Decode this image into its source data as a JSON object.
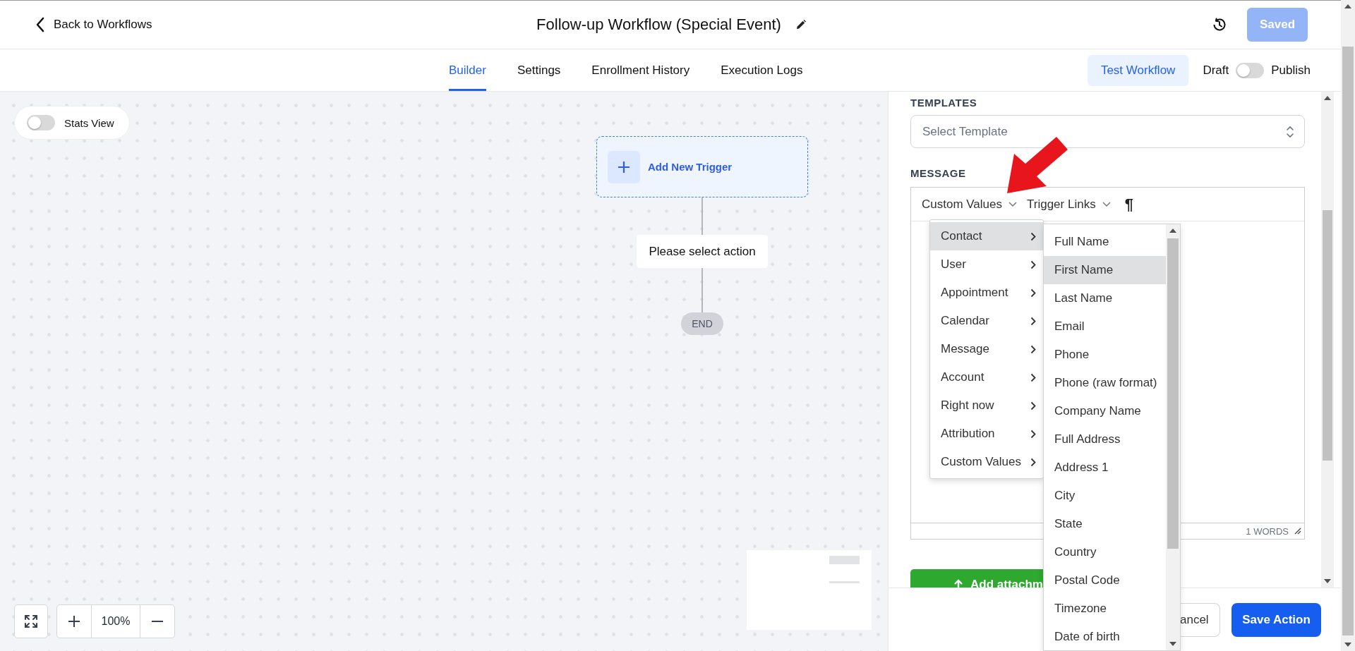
{
  "header": {
    "back_link": "Back to Workflows",
    "title": "Follow-up Workflow (Special Event)",
    "save_status": "Saved"
  },
  "tabs": [
    {
      "label": "Builder",
      "selected": true
    },
    {
      "label": "Settings",
      "selected": false
    },
    {
      "label": "Enrollment History",
      "selected": false
    },
    {
      "label": "Execution Logs",
      "selected": false
    }
  ],
  "test_button": "Test Workflow",
  "publish_toggle": {
    "off_label": "Draft",
    "on_label": "Publish",
    "on": false
  },
  "canvas": {
    "stats_view": {
      "label": "Stats View",
      "on": false
    },
    "nodes": [
      {
        "kind": "trigger",
        "label": "Add New Trigger"
      },
      {
        "kind": "action",
        "label": "Please select action"
      },
      {
        "kind": "end",
        "label": "END"
      }
    ],
    "zoom": "100%"
  },
  "panel": {
    "templates": {
      "label": "TEMPLATES",
      "placeholder": "Select Template"
    },
    "message": {
      "label": "MESSAGE",
      "toolbar": [
        {
          "kind": "dropdown",
          "label": "Custom Values"
        },
        {
          "kind": "dropdown",
          "label": "Trigger Links"
        },
        {
          "kind": "glyph",
          "label": "¶"
        }
      ],
      "word_count": "1 WORDS"
    },
    "attachment_button": "Add attachm",
    "cancel_button": "ancel",
    "save_button": "Save Action"
  },
  "menu": {
    "items": [
      {
        "label": "Contact",
        "selected": true
      },
      {
        "label": "User",
        "selected": false
      },
      {
        "label": "Appointment",
        "selected": false
      },
      {
        "label": "Calendar",
        "selected": false
      },
      {
        "label": "Message",
        "selected": false
      },
      {
        "label": "Account",
        "selected": false
      },
      {
        "label": "Right now",
        "selected": false
      },
      {
        "label": "Attribution",
        "selected": false
      },
      {
        "label": "Custom Values",
        "selected": false
      }
    ]
  },
  "submenu": {
    "items": [
      {
        "label": "Full Name",
        "selected": false
      },
      {
        "label": "First Name",
        "selected": true
      },
      {
        "label": "Last Name",
        "selected": false
      },
      {
        "label": "Email",
        "selected": false
      },
      {
        "label": "Phone",
        "selected": false
      },
      {
        "label": "Phone (raw format)",
        "selected": false
      },
      {
        "label": "Company Name",
        "selected": false
      },
      {
        "label": "Full Address",
        "selected": false
      },
      {
        "label": "Address 1",
        "selected": false
      },
      {
        "label": "City",
        "selected": false
      },
      {
        "label": "State",
        "selected": false
      },
      {
        "label": "Country",
        "selected": false
      },
      {
        "label": "Postal Code",
        "selected": false
      },
      {
        "label": "Timezone",
        "selected": false
      },
      {
        "label": "Date of birth",
        "selected": false
      }
    ]
  }
}
